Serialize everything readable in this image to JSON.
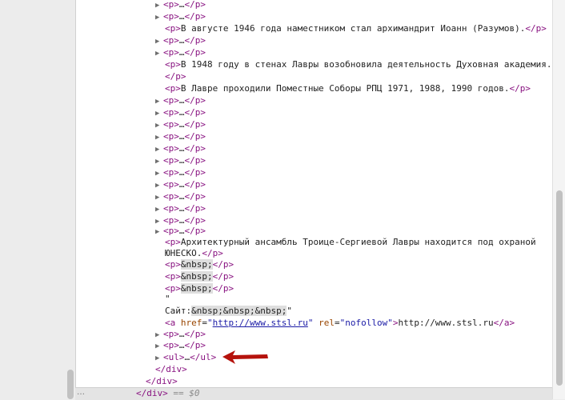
{
  "markup": {
    "open_p": "<p>",
    "close_p": "</p>",
    "ellipsis": "…",
    "open_ul": "<ul>",
    "close_ul": "</ul>",
    "close_div": "</div>",
    "nbsp_entity": "&nbsp;",
    "open_a": "<a",
    "href_attr": "href",
    "rel_attr": "rel",
    "close_a": "</a>",
    "gt": ">",
    "eq": "=",
    "quote": "\"",
    "space": " "
  },
  "paragraphs": {
    "avgust_1946": "В августе 1946 года наместником стал архимандрит Иоанн (Разумов).",
    "year_1948": "В 1948 году в стенах Лавры возобновила деятельность Духовная академия.",
    "sobory": "В Лавре проходили Поместные Соборы РПЦ 1971, 1988, 1990 годов.",
    "unesco_part1": "Архитектурный ансамбль Троице-Сергиевой Лавры находится под охраной",
    "unesco_part2": "ЮНЕСКО."
  },
  "site_text": {
    "quote_open": "\"",
    "label": "Сайт:",
    "quote_close": "\""
  },
  "link": {
    "href": "http://www.stsl.ru",
    "rel": "nofollow",
    "text": "http://www.stsl.ru"
  },
  "breadcrumb": {
    "dots": "…",
    "selected_marker": "== $0"
  }
}
